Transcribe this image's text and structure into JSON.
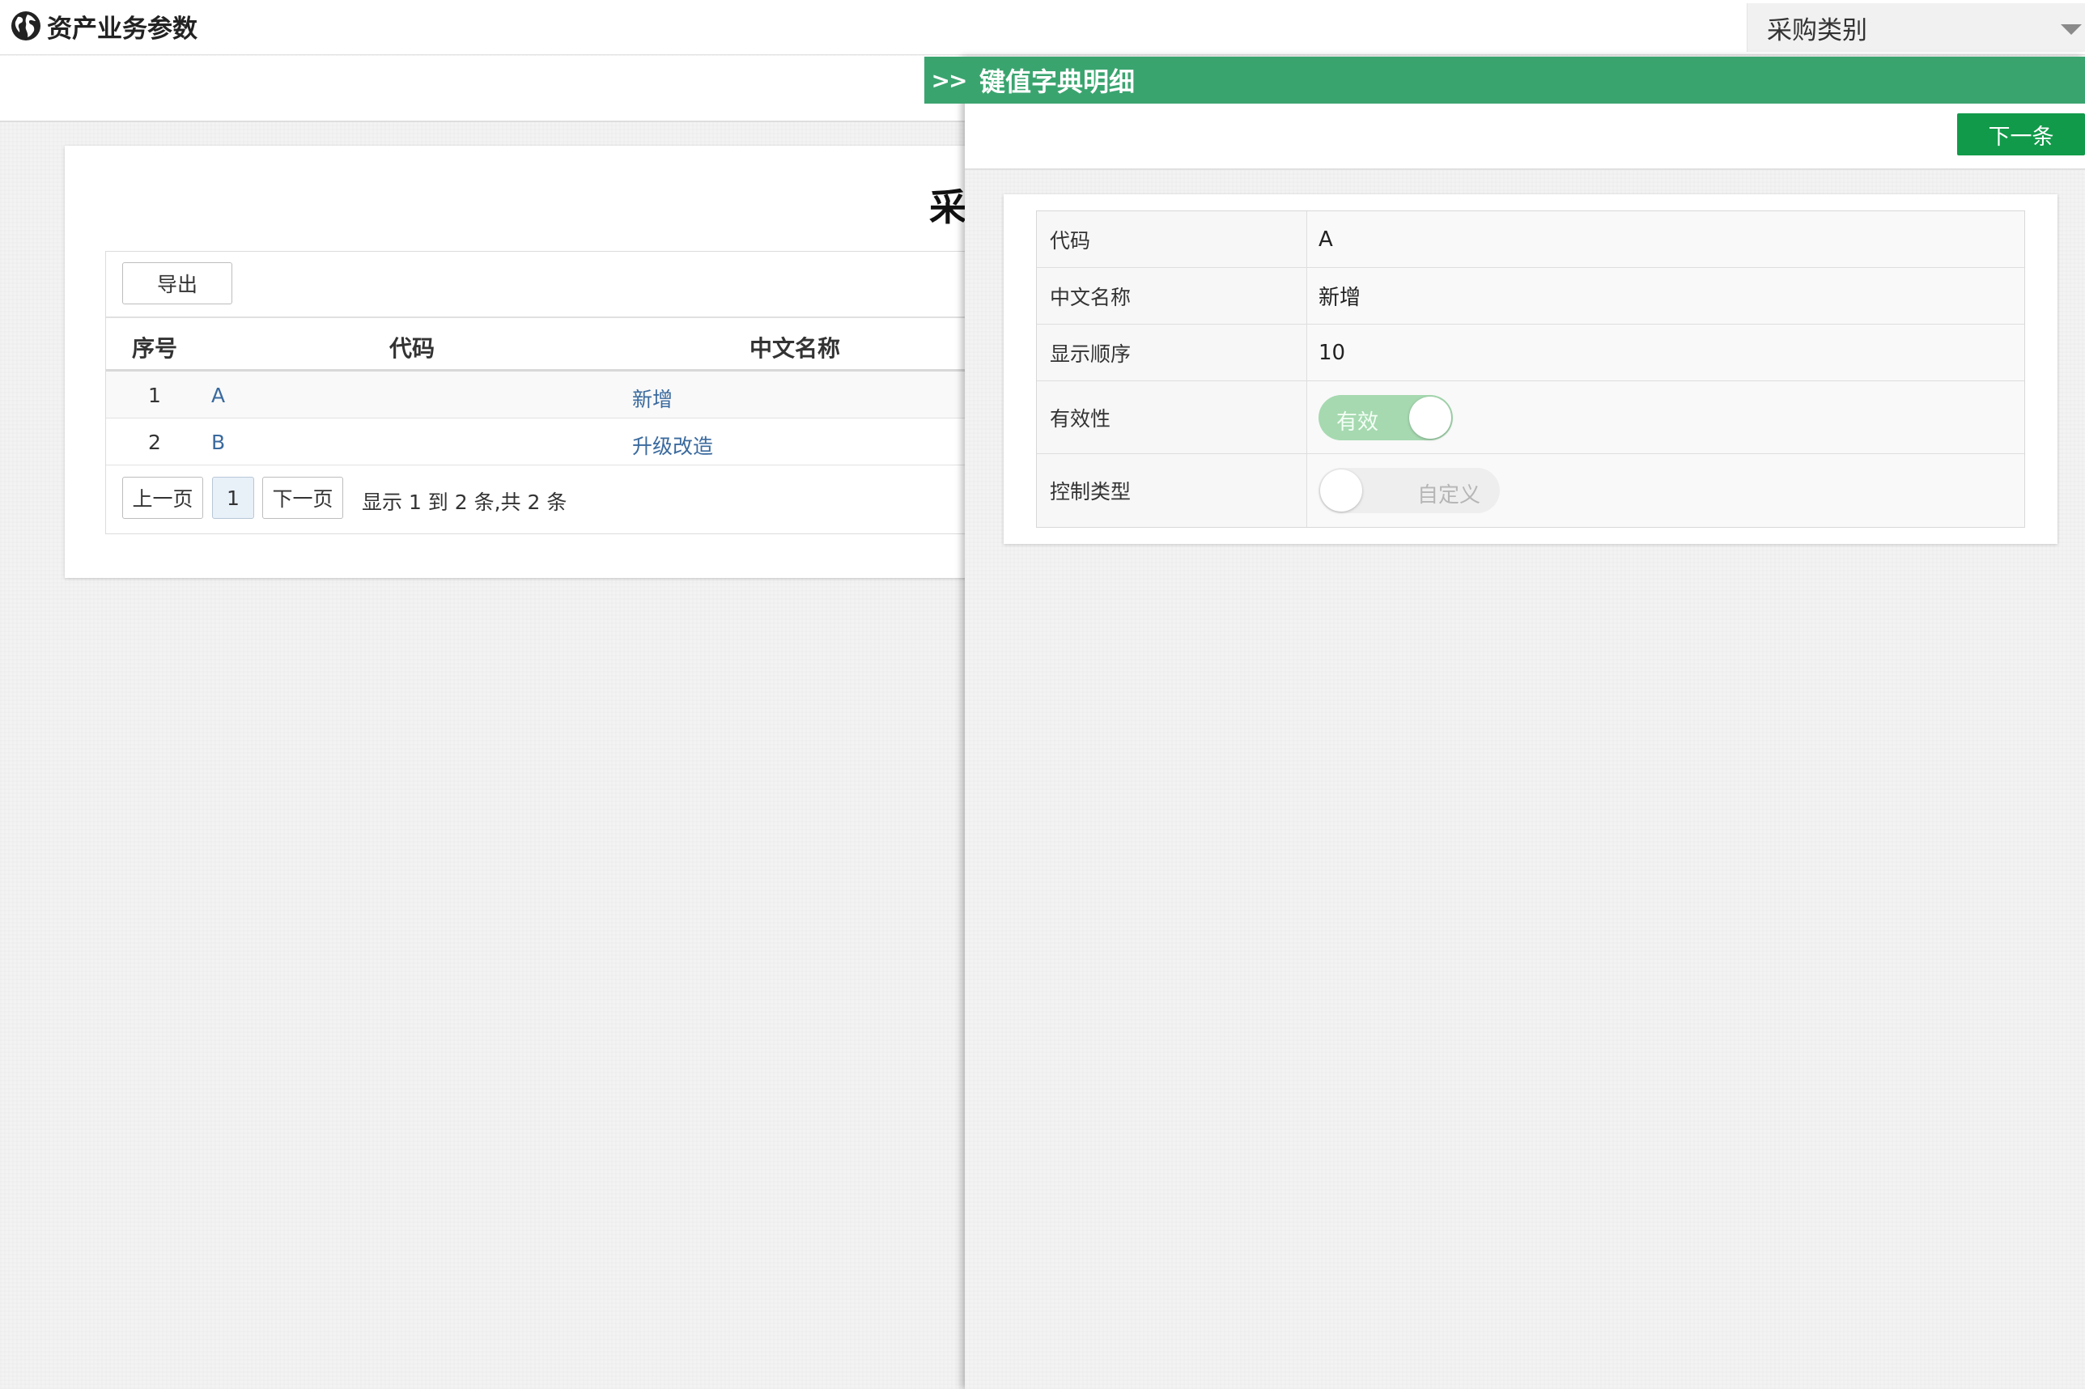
{
  "app": {
    "title": "资产业务参数",
    "category_select_value": "采购类别"
  },
  "list": {
    "heading": "采",
    "export_label": "导出",
    "columns": [
      "序号",
      "代码",
      "中文名称"
    ],
    "rows": [
      {
        "index": "1",
        "code": "A",
        "name": "新增"
      },
      {
        "index": "2",
        "code": "B",
        "name": "升级改造"
      }
    ],
    "pager": {
      "prev_label": "上一页",
      "current_page": "1",
      "next_label": "下一页",
      "info": "显示 1 到 2 条,共 2 条"
    }
  },
  "drawer": {
    "collapse_label": ">>",
    "title": "键值字典明细",
    "next_record_label": "下一条",
    "fields": [
      {
        "label": "代码",
        "value": "A"
      },
      {
        "label": "中文名称",
        "value": "新增"
      },
      {
        "label": "显示顺序",
        "value": "10"
      },
      {
        "label": "有效性",
        "toggle_text": "有效",
        "toggle_state": "on"
      },
      {
        "label": "控制类型",
        "toggle_text": "自定义",
        "toggle_state": "off"
      }
    ]
  },
  "colors": {
    "accent_green": "#3aa46f",
    "button_green": "#119a4a",
    "link_blue": "#3a6a9e",
    "toggle_on": "#a6d9b0"
  }
}
